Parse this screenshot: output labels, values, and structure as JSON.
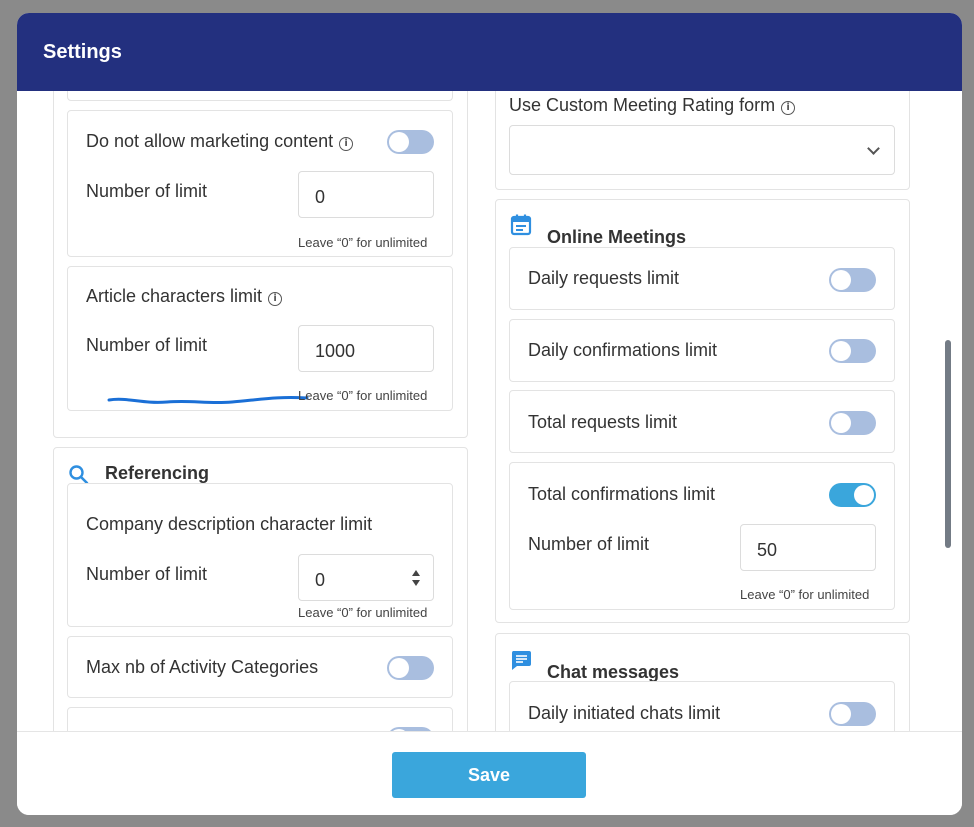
{
  "modal": {
    "title": "Settings"
  },
  "left": {
    "marketing": {
      "label": "Do not allow marketing content",
      "toggle_on": false,
      "limit_label": "Number of limit",
      "limit_value": "0",
      "hint": "Leave “0” for unlimited"
    },
    "article": {
      "label": "Article characters limit",
      "limit_label": "Number of limit",
      "limit_value": "1000",
      "hint": "Leave “0” for unlimited"
    },
    "referencing": {
      "title": "Referencing",
      "icon": "search-icon",
      "company_desc": {
        "label": "Company description character limit",
        "limit_label": "Number of limit",
        "limit_value": "0",
        "hint": "Leave “0” for unlimited"
      },
      "activity": {
        "label": "Max nb of Activity Categories",
        "toggle_on": false
      }
    }
  },
  "right": {
    "rating": {
      "label": "Use Custom Meeting Rating form",
      "selected": ""
    },
    "online_meetings": {
      "title": "Online Meetings",
      "icon": "calendar-icon",
      "items": [
        {
          "label": "Daily requests limit",
          "toggle_on": false
        },
        {
          "label": "Daily confirmations limit",
          "toggle_on": false
        },
        {
          "label": "Total requests limit",
          "toggle_on": false
        },
        {
          "label": "Total confirmations limit",
          "toggle_on": true
        }
      ],
      "total_conf": {
        "limit_label": "Number of limit",
        "limit_value": "50",
        "hint": "Leave “0” for unlimited"
      }
    },
    "chat": {
      "title": "Chat messages",
      "icon": "chat-icon",
      "items": [
        {
          "label": "Daily initiated chats limit",
          "toggle_on": false
        }
      ]
    }
  },
  "footer": {
    "save_label": "Save"
  },
  "colors": {
    "header": "#23307f",
    "accent": "#3aa6dc",
    "toggle_off": "#a9bedf",
    "annotation": "#1a6fd6"
  }
}
